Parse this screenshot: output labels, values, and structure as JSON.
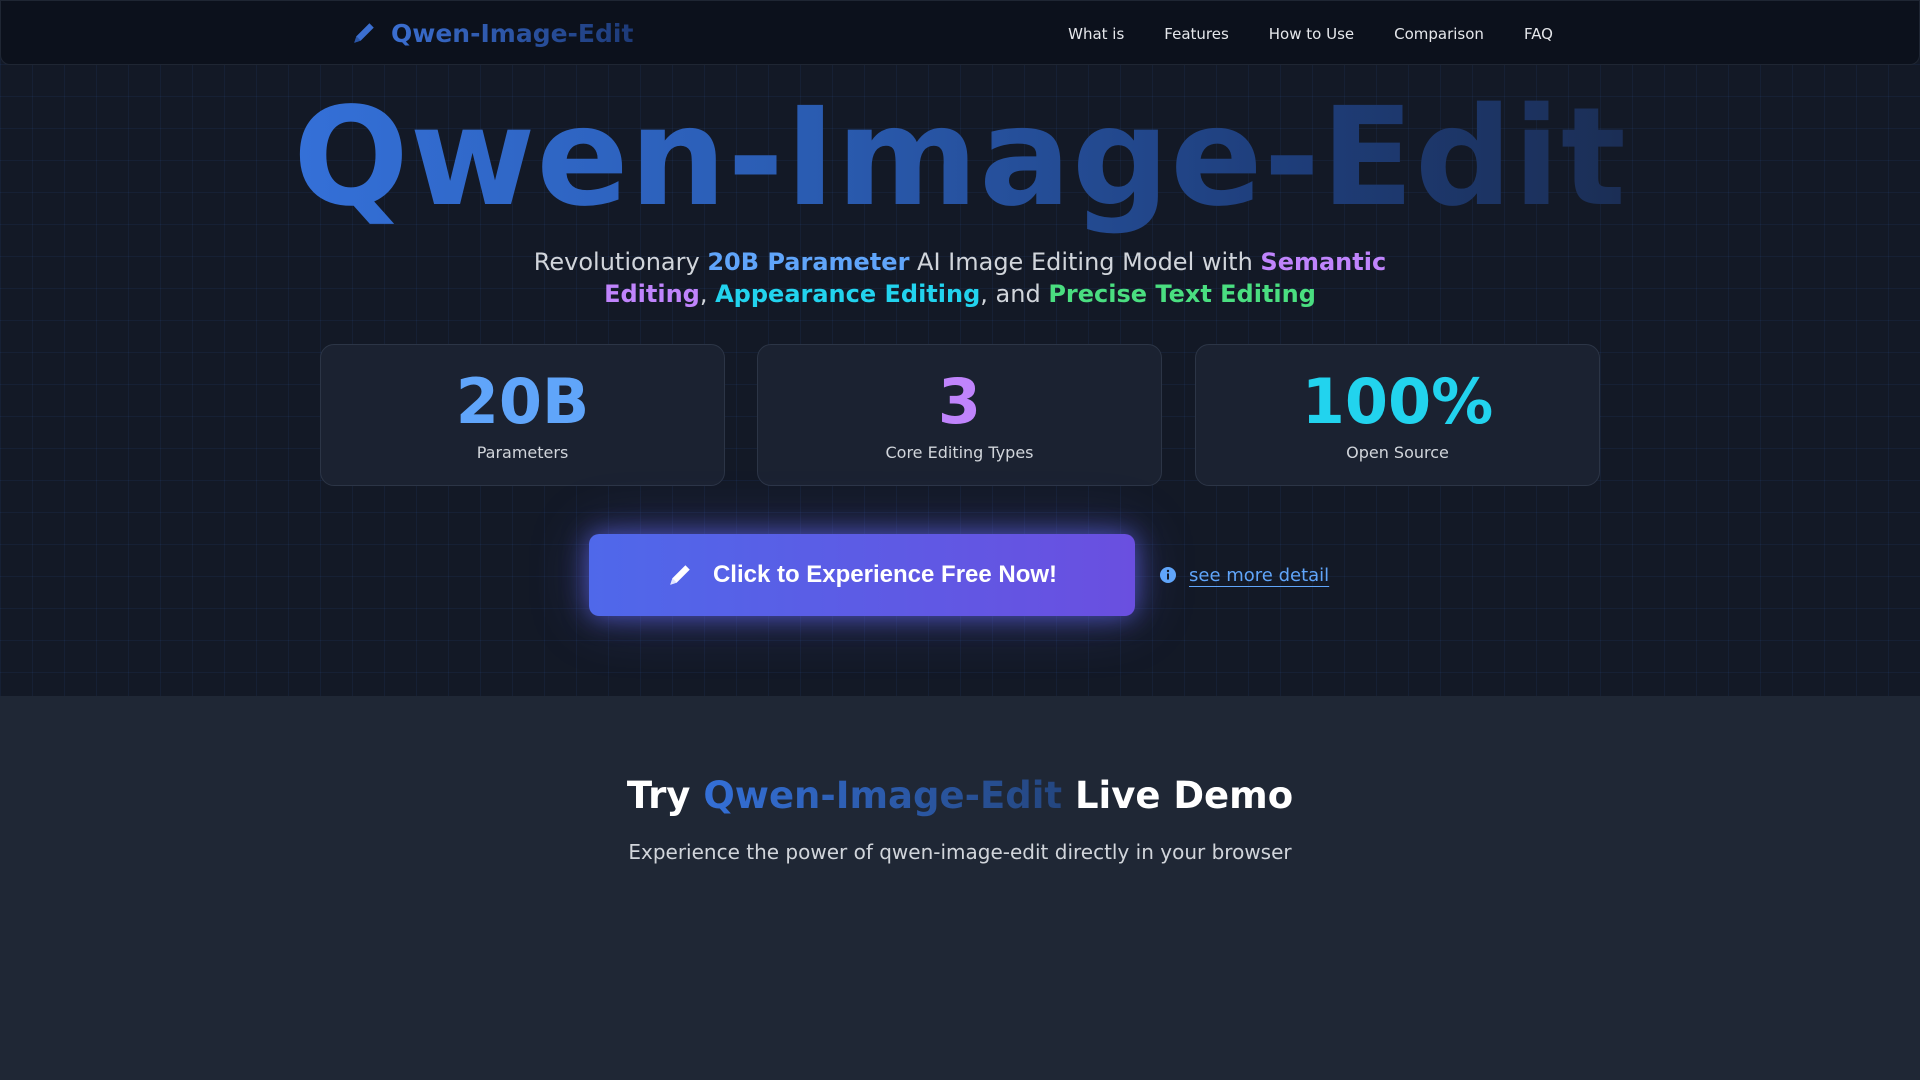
{
  "nav": {
    "brand": "Qwen-Image-Edit",
    "brand_icon": "pencil-icon",
    "links": [
      "What is",
      "Features",
      "How to Use",
      "Comparison",
      "FAQ"
    ]
  },
  "hero": {
    "title": "Qwen-Image-Edit",
    "subtitle": {
      "p1": "Revolutionary ",
      "h1": "20B Parameter",
      "p2": " AI Image Editing Model with ",
      "h2": "Semantic Editing",
      "p3": ", ",
      "h3": "Appearance Editing",
      "p4": ", and ",
      "h4": "Precise Text Editing"
    },
    "stats": [
      {
        "value": "20B",
        "label": "Parameters",
        "color": "#60a5fa"
      },
      {
        "value": "3",
        "label": "Core Editing Types",
        "color": "#c084fc"
      },
      {
        "value": "100%",
        "label": "Open Source",
        "color": "#22d3ee"
      }
    ],
    "cta": {
      "label": "Click to Experience Free Now!",
      "icon": "pencil-icon"
    },
    "more": {
      "label": "see more detail",
      "icon": "info-icon"
    }
  },
  "demo": {
    "title_pre": "Try ",
    "title_brand": "Qwen-Image-Edit",
    "title_post": " Live Demo",
    "subtitle": "Experience the power of qwen-image-edit directly in your browser"
  },
  "colors": {
    "accent_blue": "#3b82f6",
    "cta_gradient_start": "#4f68ea",
    "cta_gradient_end": "#6a4fe0"
  }
}
